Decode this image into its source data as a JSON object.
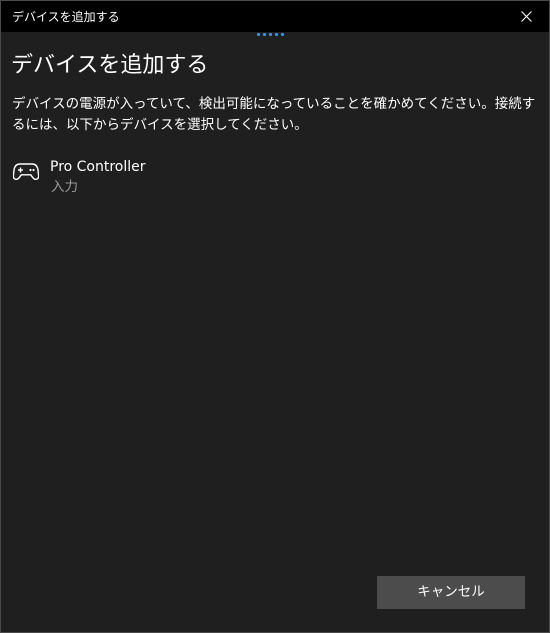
{
  "window": {
    "title": "デバイスを追加する"
  },
  "dialog": {
    "heading": "デバイスを追加する",
    "description": "デバイスの電源が入っていて、検出可能になっていることを確かめてください。接続するには、以下からデバイスを選択してください。"
  },
  "devices": [
    {
      "name": "Pro Controller",
      "type": "入力",
      "icon": "gamepad-icon"
    }
  ],
  "actions": {
    "cancel_label": "キャンセル"
  },
  "colors": {
    "background": "#1f1f1f",
    "titlebar": "#000000",
    "accent": "#3d8ee8",
    "button": "#4c4c4c",
    "secondary_text": "#9a9a9a"
  }
}
